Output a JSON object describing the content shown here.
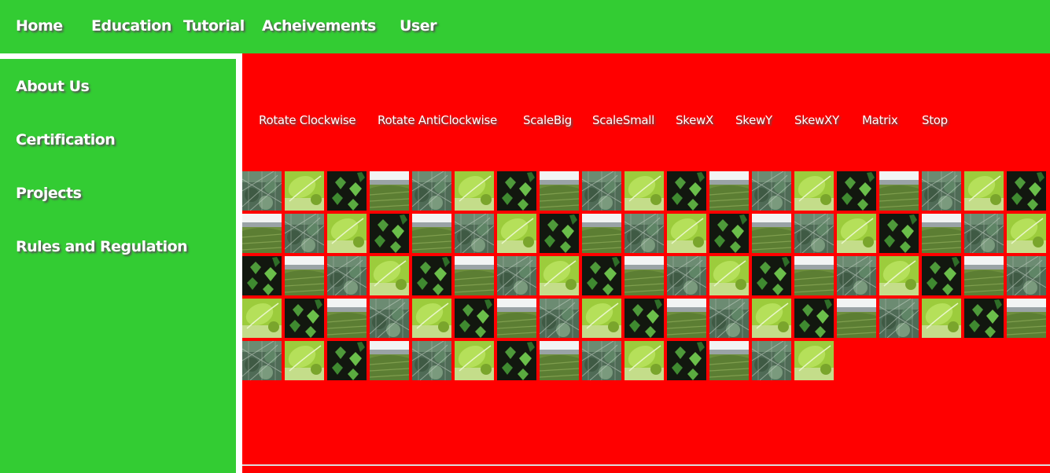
{
  "topnav": {
    "items": [
      {
        "id": "home",
        "label": "Home"
      },
      {
        "id": "education",
        "label": "Education"
      },
      {
        "id": "tutorial",
        "label": "Tutorial"
      },
      {
        "id": "achievements",
        "label": "Acheivements"
      },
      {
        "id": "user",
        "label": "User"
      }
    ]
  },
  "sidebar": {
    "items": [
      {
        "id": "about-us",
        "label": "About Us"
      },
      {
        "id": "certification",
        "label": "Certification"
      },
      {
        "id": "projects",
        "label": "Projects"
      },
      {
        "id": "rules",
        "label": "Rules and Regulation"
      }
    ]
  },
  "controls": {
    "buttons": [
      {
        "id": "rotate-clockwise",
        "label": "Rotate Clockwise"
      },
      {
        "id": "rotate-anticlockwise",
        "label": "Rotate AntiClockwise"
      },
      {
        "id": "scale-big",
        "label": "ScaleBig"
      },
      {
        "id": "scale-small",
        "label": "ScaleSmall"
      },
      {
        "id": "skew-x",
        "label": "SkewX"
      },
      {
        "id": "skew-y",
        "label": "SkewY"
      },
      {
        "id": "skew-xy",
        "label": "SkewXY"
      },
      {
        "id": "matrix",
        "label": "Matrix"
      },
      {
        "id": "stop",
        "label": "Stop"
      }
    ]
  },
  "gallery": {
    "rows": [
      [
        "fence",
        "leaf",
        "ivy",
        "field",
        "fence",
        "leaf",
        "ivy",
        "field",
        "fence",
        "leaf",
        "ivy",
        "field",
        "fence",
        "leaf",
        "ivy",
        "field",
        "fence",
        "leaf",
        "ivy"
      ],
      [
        "field",
        "fence",
        "leaf",
        "ivy",
        "field",
        "fence",
        "leaf",
        "ivy",
        "field",
        "fence",
        "leaf",
        "ivy",
        "field",
        "fence",
        "leaf",
        "ivy",
        "field",
        "fence",
        "leaf"
      ],
      [
        "ivy",
        "field",
        "fence",
        "leaf",
        "ivy",
        "field",
        "fence",
        "leaf",
        "ivy",
        "field",
        "fence",
        "leaf",
        "ivy",
        "field",
        "fence",
        "leaf",
        "ivy",
        "field",
        "fence"
      ],
      [
        "leaf",
        "ivy",
        "field",
        "fence",
        "leaf",
        "ivy",
        "field",
        "fence",
        "leaf",
        "ivy",
        "field",
        "fence",
        "leaf",
        "ivy",
        "field",
        "fence",
        "leaf",
        "ivy",
        "field"
      ],
      [
        "fence",
        "leaf",
        "ivy",
        "field",
        "fence",
        "leaf",
        "ivy",
        "field",
        "fence",
        "leaf",
        "ivy",
        "field",
        "fence",
        "leaf"
      ]
    ]
  },
  "colors": {
    "nav_green": "#33cc33",
    "main_red": "#ff0000",
    "text": "#ffffff"
  }
}
